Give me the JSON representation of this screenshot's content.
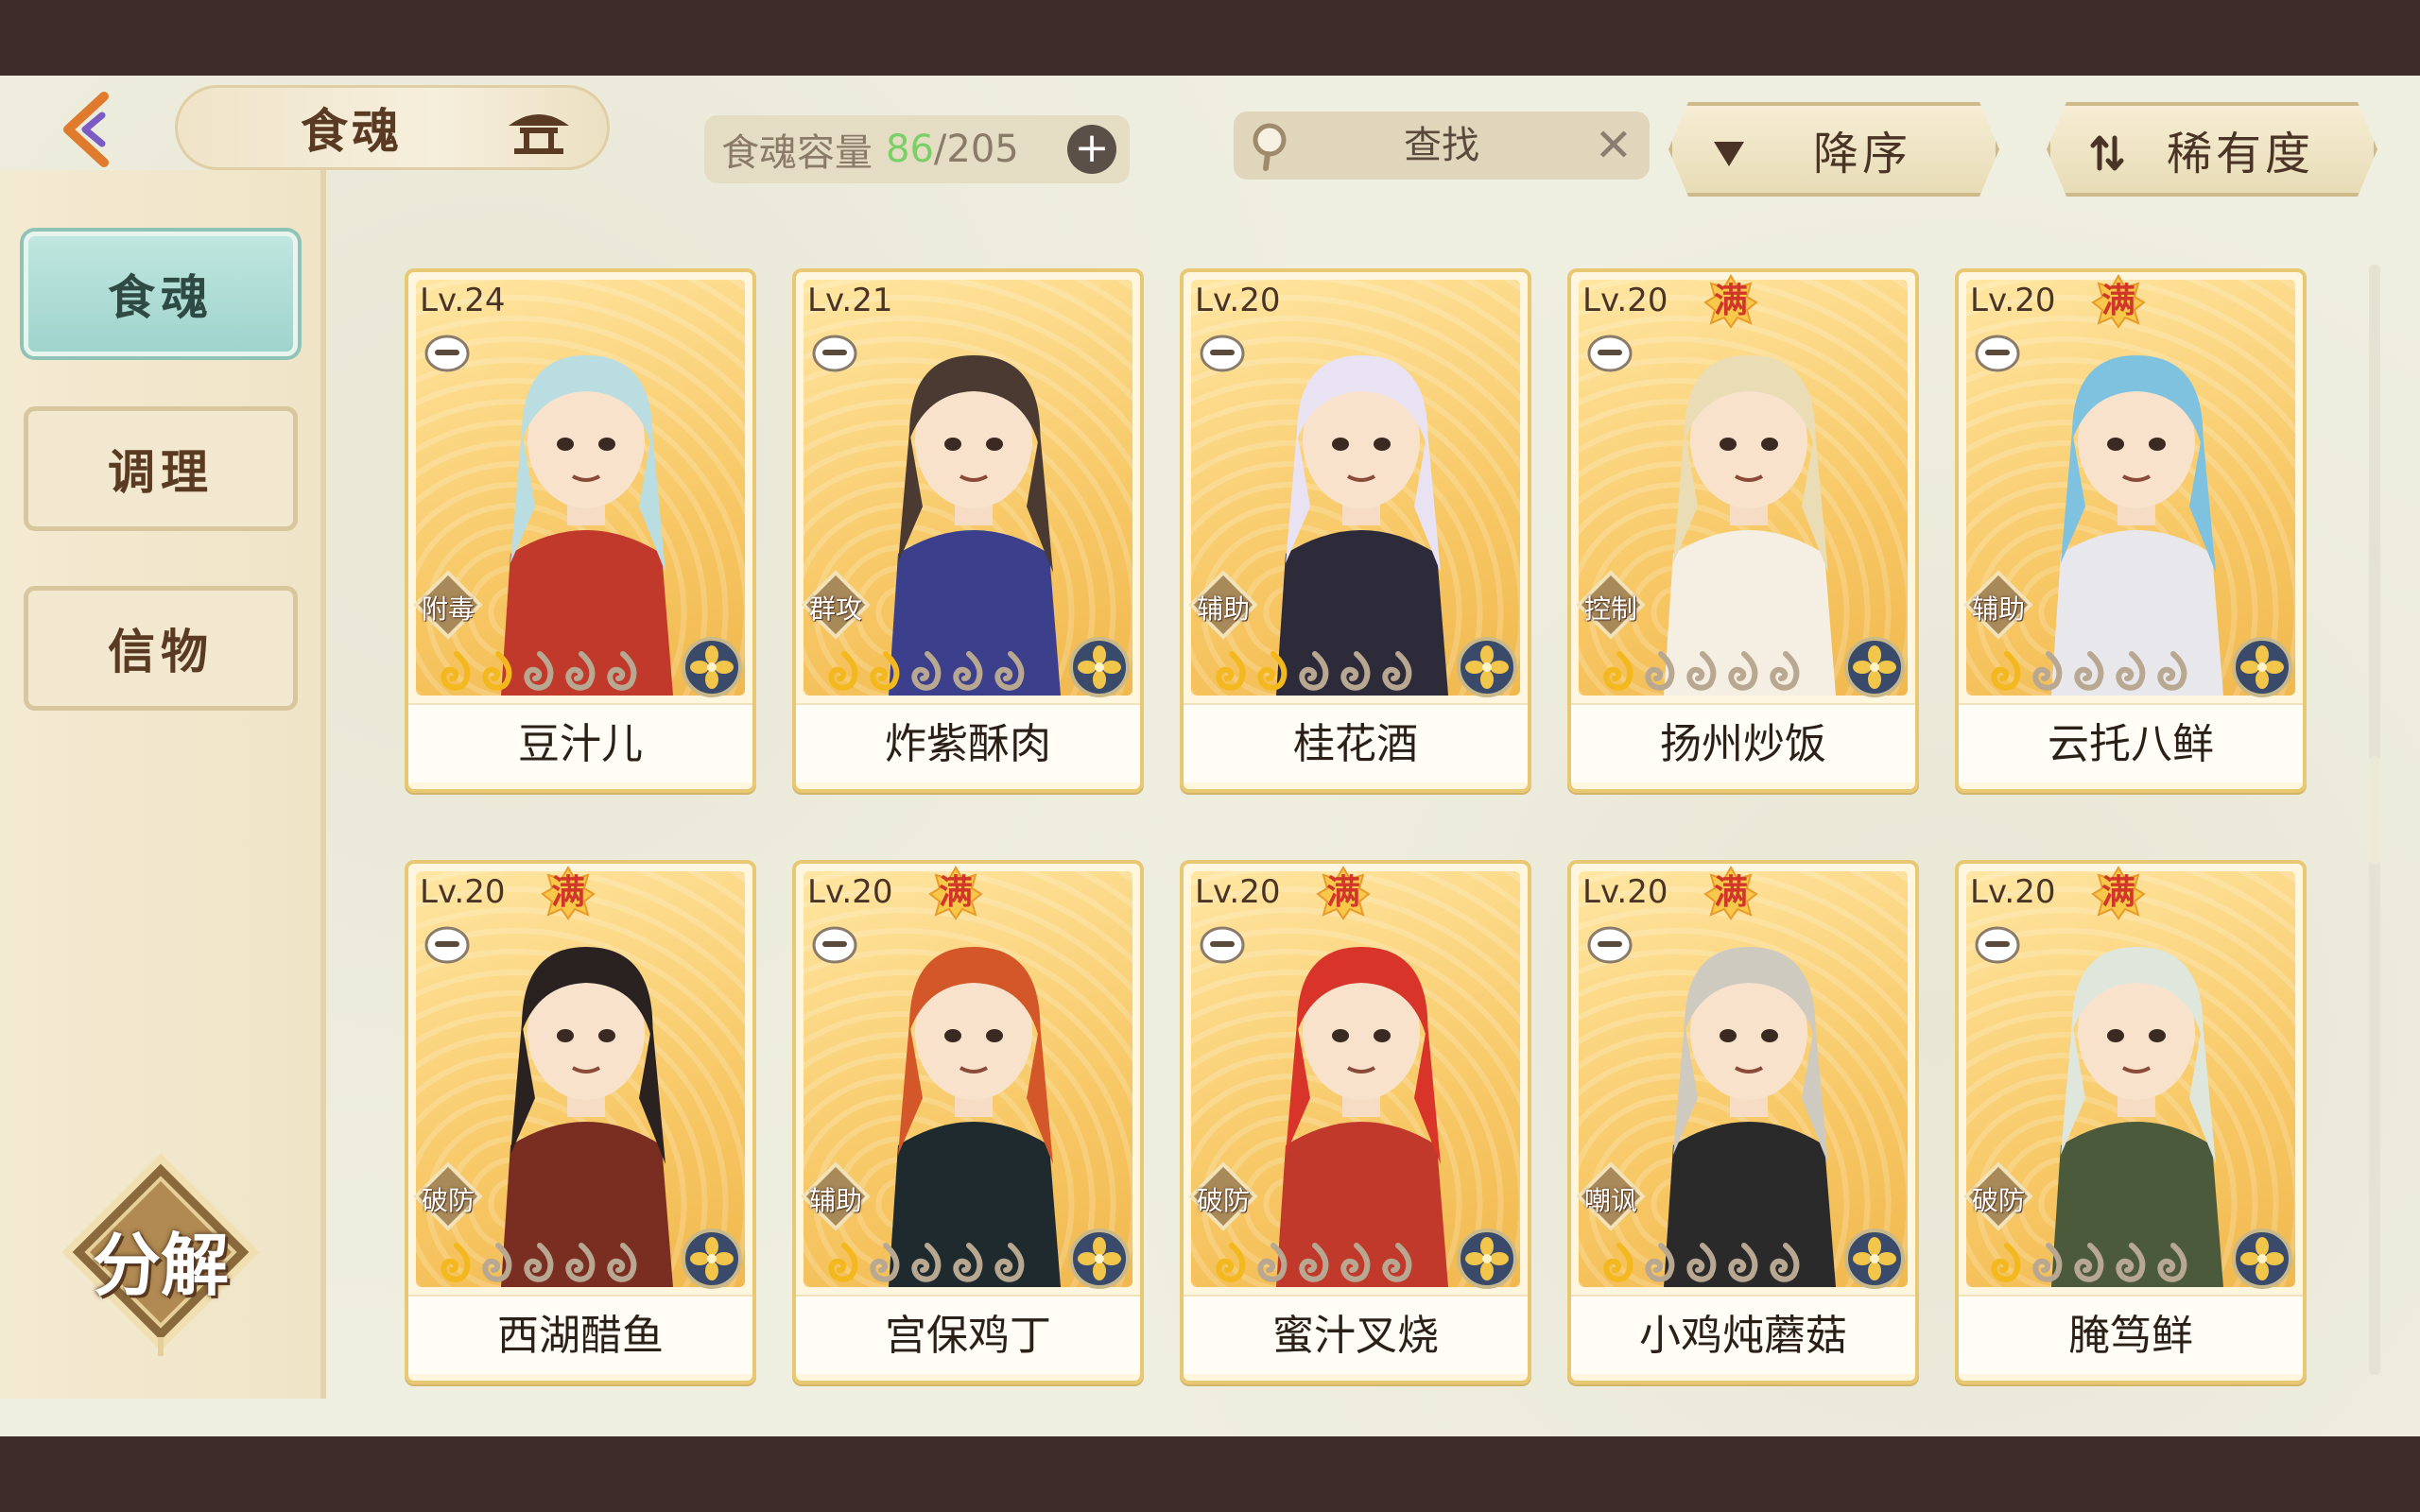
{
  "header": {
    "title": "食魂",
    "capacity_label": "食魂容量",
    "capacity_current": "86",
    "capacity_max": "/205",
    "capacity_add": "+",
    "search_placeholder": "查找",
    "search_clear": "✕",
    "sort_order_label": "降序",
    "sort_key_label": "稀有度"
  },
  "sidebar": {
    "tabs": [
      {
        "label": "食魂",
        "active": true
      },
      {
        "label": "调理",
        "active": false
      },
      {
        "label": "信物",
        "active": false
      }
    ],
    "decompose_label": "分解"
  },
  "cards": [
    {
      "level": "Lv.24",
      "full": false,
      "full_label": "",
      "role": "附毒",
      "stars": 2,
      "name": "豆汁儿",
      "hair": "#b9dde0",
      "cloth": "#c0392b"
    },
    {
      "level": "Lv.21",
      "full": false,
      "full_label": "",
      "role": "群攻",
      "stars": 2,
      "name": "炸紫酥肉",
      "hair": "#4a3a32",
      "cloth": "#3b3f8c"
    },
    {
      "level": "Lv.20",
      "full": false,
      "full_label": "",
      "role": "辅助",
      "stars": 2,
      "name": "桂花酒",
      "hair": "#e8e2f2",
      "cloth": "#2d2a3a"
    },
    {
      "level": "Lv.20",
      "full": true,
      "full_label": "满",
      "role": "控制",
      "stars": 1,
      "name": "扬州炒饭",
      "hair": "#eadcb4",
      "cloth": "#f4efe2"
    },
    {
      "level": "Lv.20",
      "full": true,
      "full_label": "满",
      "role": "辅助",
      "stars": 1,
      "name": "云托八鲜",
      "hair": "#7fc2e0",
      "cloth": "#e8e8ec"
    },
    {
      "level": "Lv.20",
      "full": true,
      "full_label": "满",
      "role": "破防",
      "stars": 1,
      "name": "西湖醋鱼",
      "hair": "#2a2220",
      "cloth": "#7a2e22"
    },
    {
      "level": "Lv.20",
      "full": true,
      "full_label": "满",
      "role": "辅助",
      "stars": 1,
      "name": "宫保鸡丁",
      "hair": "#d4572a",
      "cloth": "#1f2a2e"
    },
    {
      "level": "Lv.20",
      "full": true,
      "full_label": "满",
      "role": "破防",
      "stars": 1,
      "name": "蜜汁叉烧",
      "hair": "#d8342a",
      "cloth": "#c0392b"
    },
    {
      "level": "Lv.20",
      "full": true,
      "full_label": "满",
      "role": "嘲讽",
      "stars": 1,
      "name": "小鸡炖蘑菇",
      "hair": "#cfcac0",
      "cloth": "#2a2a2a"
    },
    {
      "level": "Lv.20",
      "full": true,
      "full_label": "满",
      "role": "破防",
      "stars": 1,
      "name": "腌笃鲜",
      "hair": "#dfe6dc",
      "cloth": "#4a5a3a"
    }
  ],
  "colors": {
    "accent_teal": "#9fd4cc",
    "gold_border": "#e8c873",
    "capacity_current": "#7ad064",
    "full_badge": "#d2362a"
  }
}
